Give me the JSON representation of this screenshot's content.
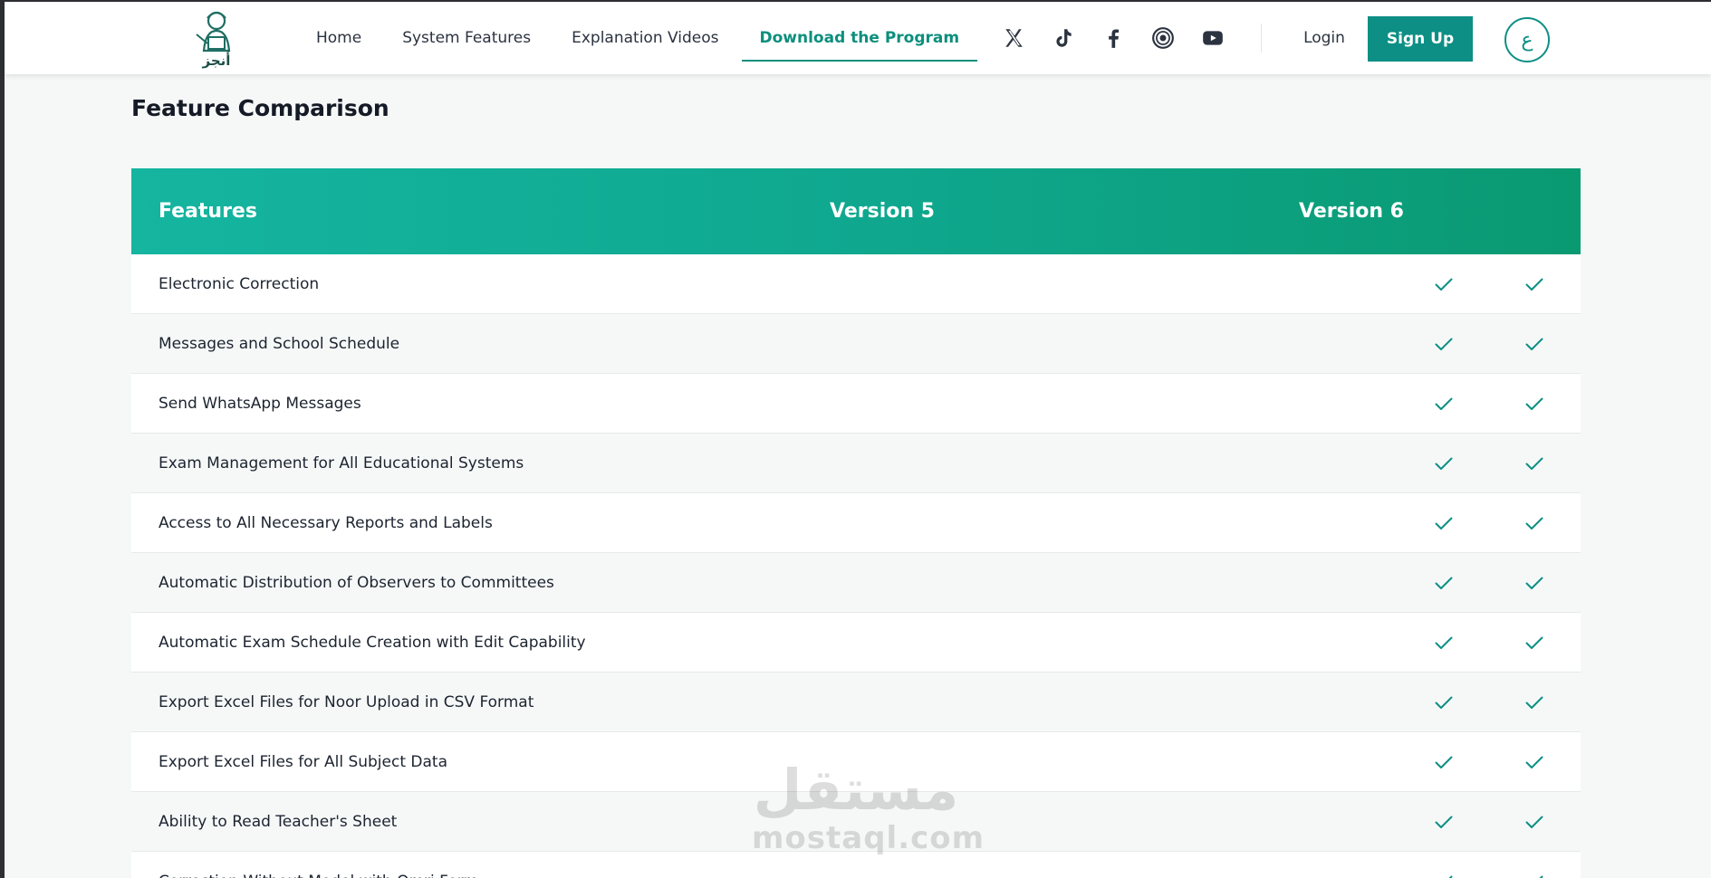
{
  "header": {
    "logo_text": "أنجز",
    "nav": [
      {
        "label": "Home",
        "active": false
      },
      {
        "label": "System Features",
        "active": false
      },
      {
        "label": "Explanation Videos",
        "active": false
      },
      {
        "label": "Download the Program",
        "active": true
      }
    ],
    "socials": [
      "x-icon",
      "tiktok-icon",
      "facebook-icon",
      "snapchat-icon",
      "youtube-icon"
    ],
    "login_label": "Login",
    "signup_label": "Sign Up",
    "language_toggle": "ع"
  },
  "colors": {
    "accent": "#0d8f85",
    "header_gradient_start": "#15b5a0",
    "header_gradient_end": "#0a9a72"
  },
  "comparison": {
    "title": "Feature Comparison",
    "columns": [
      "Features",
      "Version 5",
      "Version 6"
    ],
    "rows": [
      {
        "feature": "Electronic Correction",
        "v5": true,
        "v6": true
      },
      {
        "feature": "Messages and School Schedule",
        "v5": true,
        "v6": true
      },
      {
        "feature": "Send WhatsApp Messages",
        "v5": true,
        "v6": true
      },
      {
        "feature": "Exam Management for All Educational Systems",
        "v5": true,
        "v6": true
      },
      {
        "feature": "Access to All Necessary Reports and Labels",
        "v5": true,
        "v6": true
      },
      {
        "feature": "Automatic Distribution of Observers to Committees",
        "v5": true,
        "v6": true
      },
      {
        "feature": "Automatic Exam Schedule Creation with Edit Capability",
        "v5": true,
        "v6": true
      },
      {
        "feature": "Export Excel Files for Noor Upload in CSV Format",
        "v5": true,
        "v6": true
      },
      {
        "feature": "Export Excel Files for All Subject Data",
        "v5": true,
        "v6": true
      },
      {
        "feature": "Ability to Read Teacher's Sheet",
        "v5": true,
        "v6": true
      },
      {
        "feature": "Correction Without Model with Omri Form",
        "v5": true,
        "v6": true
      }
    ]
  },
  "watermark": {
    "arabic": "مستقل",
    "latin": "mostaql.com"
  }
}
